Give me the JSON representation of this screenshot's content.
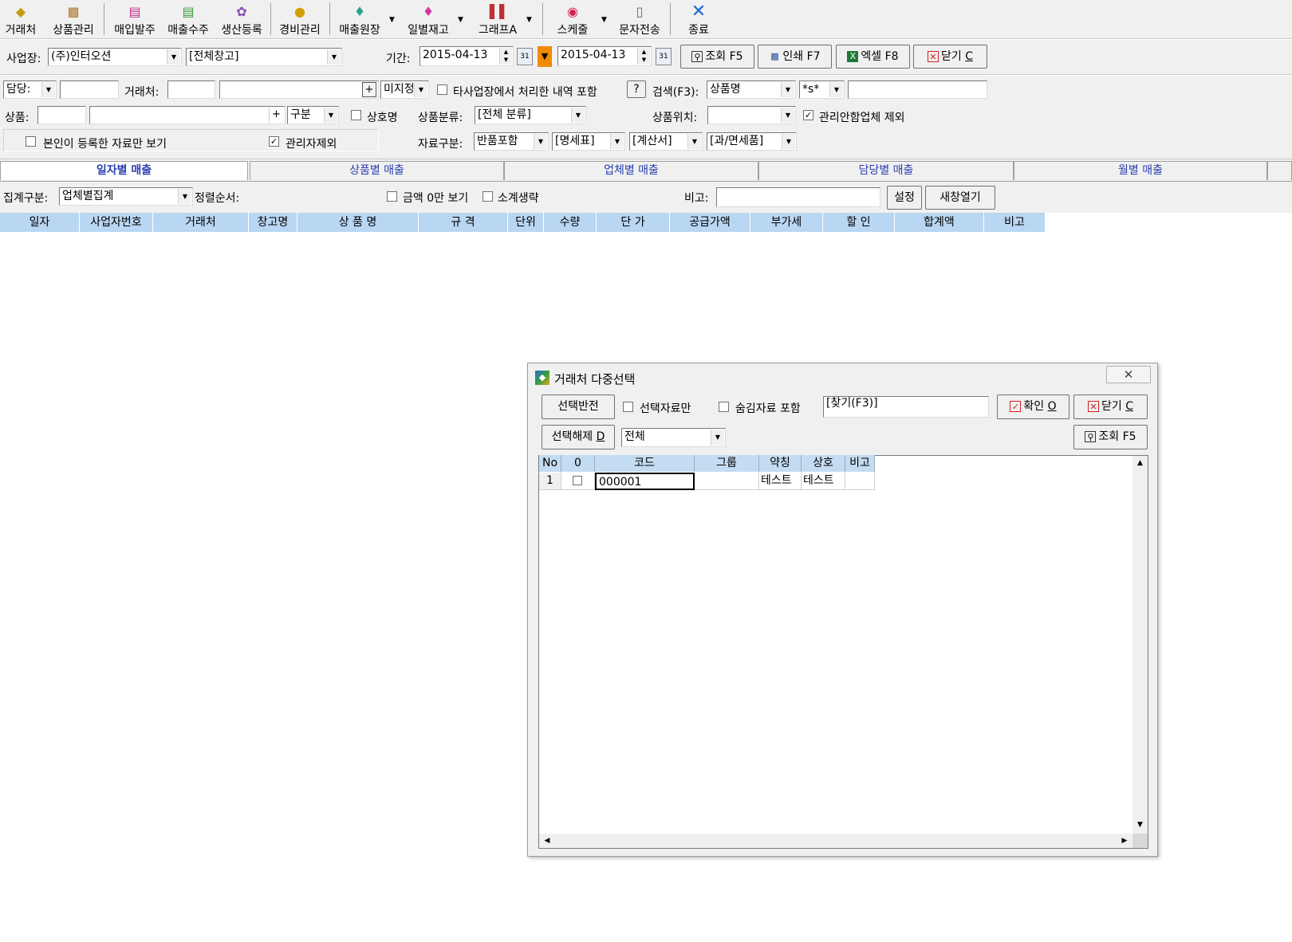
{
  "toolbar": {
    "items": [
      {
        "label": "거래처",
        "icon": "binoculars-icon"
      },
      {
        "label": "상품관리",
        "icon": "box-icon"
      },
      {
        "label": "매입발주",
        "icon": "order-sheet-icon"
      },
      {
        "label": "매출수주",
        "icon": "sales-sheet-icon"
      },
      {
        "label": "생산등록",
        "icon": "production-icon"
      },
      {
        "label": "경비관리",
        "icon": "coins-icon"
      },
      {
        "label": "매출원장",
        "icon": "ledger-icon"
      },
      {
        "label": "일별재고",
        "icon": "stock-icon"
      },
      {
        "label": "그래프A",
        "icon": "bar-graph-icon"
      },
      {
        "label": "스케줄",
        "icon": "schedule-icon"
      },
      {
        "label": "문자전송",
        "icon": "phone-icon"
      },
      {
        "label": "종료",
        "icon": "exit-x-icon"
      }
    ]
  },
  "filter1": {
    "biz_label": "사업장:",
    "biz_value": "(주)인터오션",
    "warehouse_value": "[전체창고]",
    "period_label": "기간:",
    "date_from": "2015-04-13",
    "date_to": "2015-04-13",
    "btn_query": "조회 F5",
    "btn_print": "인쇄 F7",
    "btn_excel": "엑셀 F8",
    "btn_close": "닫기",
    "btn_close_key": "C"
  },
  "filter2": {
    "manager_label": "담당:",
    "client_label": "거래처:",
    "plus": "+",
    "unassigned_value": "미지정",
    "other_biz_label": "타사업장에서 처리한 내역 포함",
    "help_btn": "?",
    "search_label": "검색(F3):",
    "search_field_value": "상품명",
    "match_value": "*s*",
    "product_label": "상품:",
    "category_value": "구분",
    "company_name_label": "상호명",
    "product_class_label": "상품분류:",
    "product_class_value": "[전체 분류]",
    "product_loc_label": "상품위치:",
    "exclude_unmanaged_label": "관리안함업체 제외",
    "own_only_label": "본인이 등록한 자료만 보기",
    "exclude_admin_label": "관리자제외",
    "data_type_label": "자료구분:",
    "data_type_1": "반품포함",
    "data_type_2": "[명세표]",
    "data_type_3": "[계산서]",
    "data_type_4": "[과/면세품]"
  },
  "tabs": [
    "일자별 매출",
    "상품별 매출",
    "업체별 매출",
    "담당별 매출",
    "월별 매출"
  ],
  "options": {
    "agg_label": "집계구분:",
    "agg_value": "업체별집계",
    "sort_label": "정렬순서:",
    "hide_zero_label": "금액 0만 보기",
    "omit_subtotal_label": "소계생략",
    "note_label": "비고:",
    "btn_settings": "설정",
    "btn_new_window": "새창열기"
  },
  "grid_headers": [
    "일자",
    "사업자번호",
    "거래처",
    "창고명",
    "상 품 명",
    "규 격",
    "단위",
    "수량",
    "단 가",
    "공급가액",
    "부가세",
    "할 인",
    "합계액",
    "비고"
  ],
  "dialog": {
    "title": "거래처 다중선택",
    "btn_invert": "선택반전",
    "selected_only_label": "선택자료만",
    "hidden_include_label": "숨김자료 포함",
    "find_value": "[찾기(F3)]",
    "btn_ok": "확인",
    "btn_ok_key": "O",
    "btn_close": "닫기",
    "btn_close_key": "C",
    "btn_deselect": "선택해제",
    "btn_deselect_key": "D",
    "filter_value": "전체",
    "btn_query": "조회 F5",
    "headers": [
      "No",
      "0",
      "코드",
      "그룹",
      "약칭",
      "상호",
      "비고"
    ],
    "rows": [
      {
        "no": "1",
        "code": "000001",
        "group": "",
        "abbr": "테스트",
        "name": "테스트",
        "note": ""
      }
    ]
  }
}
